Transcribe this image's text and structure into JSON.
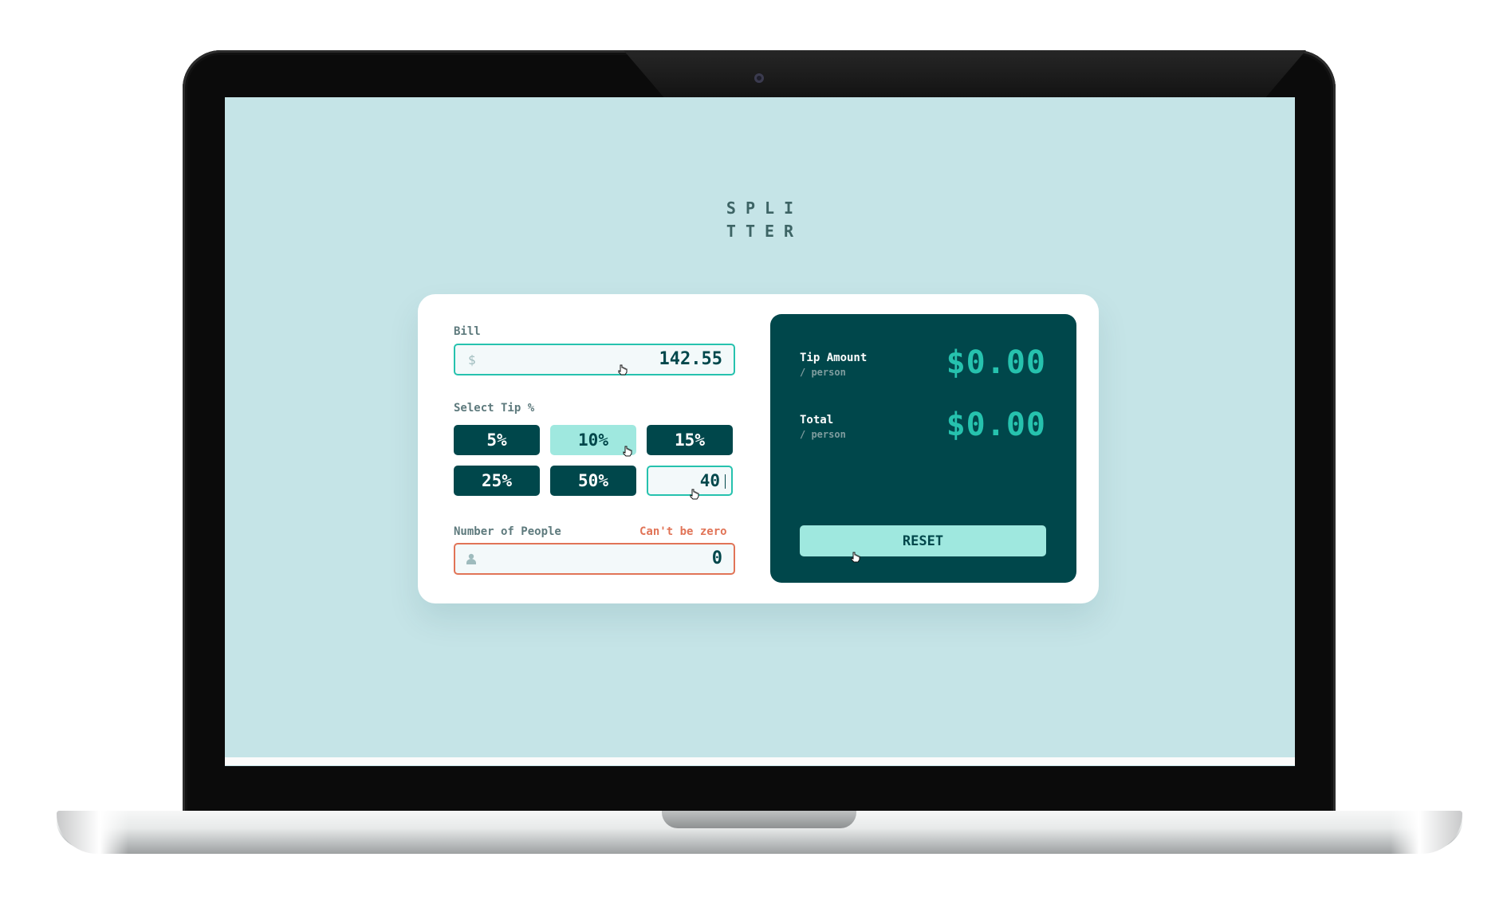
{
  "app": {
    "logo_line1": "SPLI",
    "logo_line2": "TTER"
  },
  "bill": {
    "label": "Bill",
    "currency_symbol": "$",
    "value": "142.55"
  },
  "tip": {
    "label": "Select Tip %",
    "options": [
      "5%",
      "10%",
      "15%",
      "25%",
      "50%"
    ],
    "selected": "10%",
    "custom_value": "40"
  },
  "people": {
    "label": "Number of People",
    "error": "Can't be zero",
    "value": "0",
    "icon": "person-icon"
  },
  "results": {
    "tip_amount_label": "Tip Amount",
    "tip_amount_sub": "/ person",
    "tip_amount_value": "$0.00",
    "total_label": "Total",
    "total_sub": "/ person",
    "total_value": "$0.00",
    "reset_label": "RESET"
  },
  "colors": {
    "background": "#c5e4e7",
    "dark_teal": "#00474b",
    "accent": "#26c2ae",
    "light_accent": "#9fe8df",
    "error": "#e17457"
  }
}
